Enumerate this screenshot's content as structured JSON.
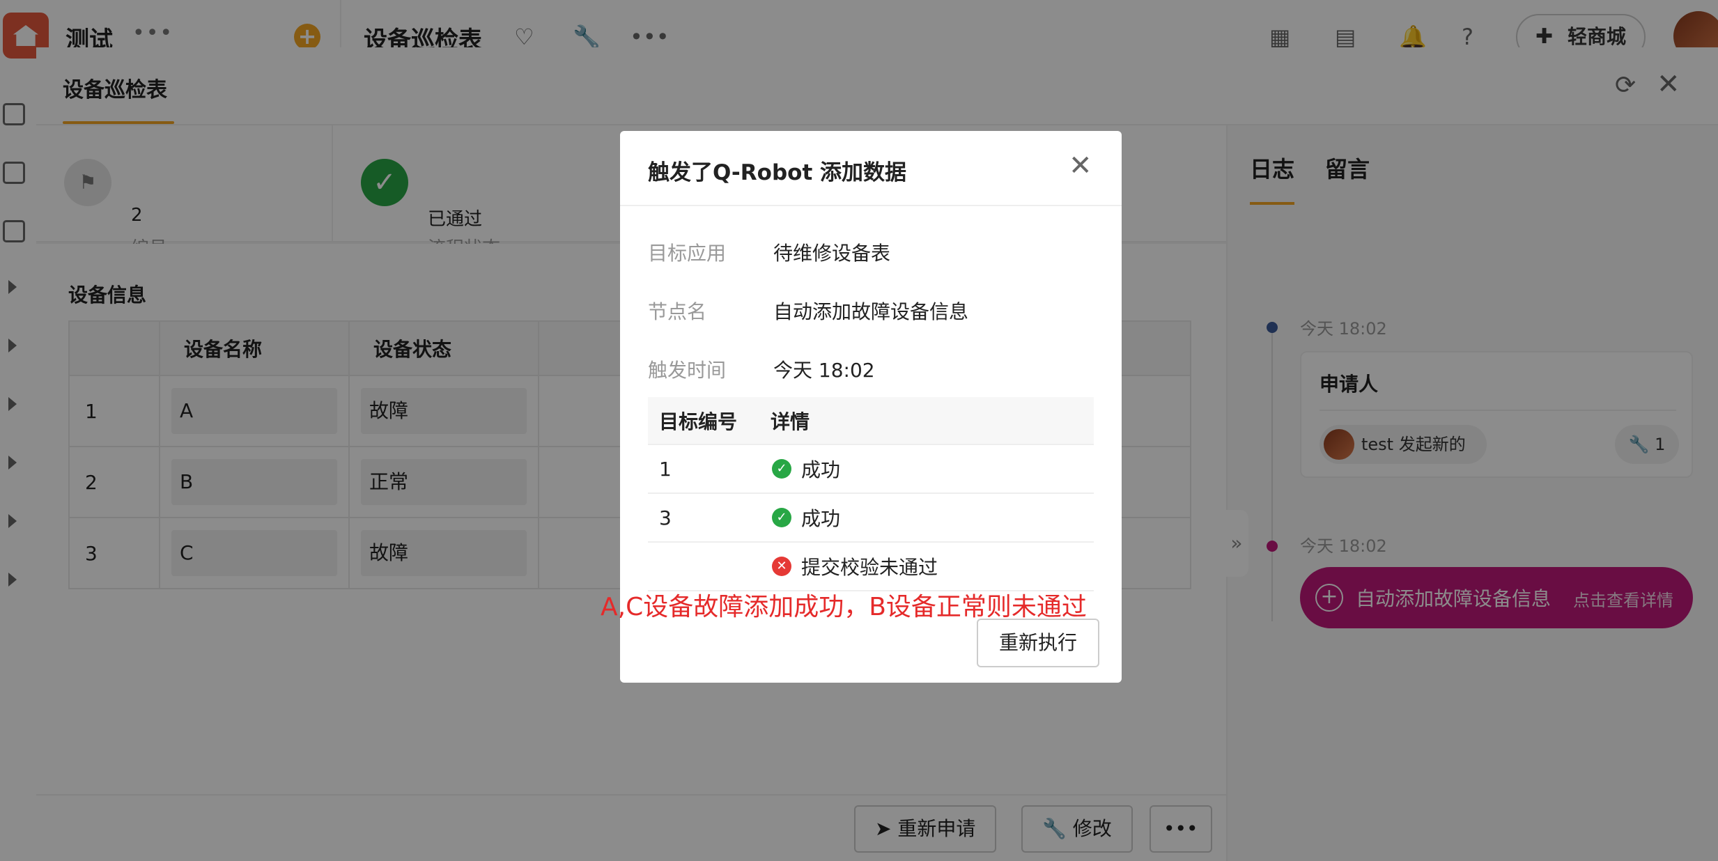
{
  "app": {
    "title": "测试",
    "form_title": "设备巡检表",
    "mall_label": "轻商城"
  },
  "drawer": {
    "tab_label": "设备巡检表",
    "summary": {
      "number_value": "2",
      "number_label": "编号",
      "status_value": "已通过",
      "status_label": "流程状态"
    },
    "section_title": "设备信息",
    "table": {
      "headers": [
        "",
        "设备名称",
        "设备状态",
        ""
      ],
      "rows": [
        {
          "index": "1",
          "name": "A",
          "status": "故障"
        },
        {
          "index": "2",
          "name": "B",
          "status": "正常"
        },
        {
          "index": "3",
          "name": "C",
          "status": "故障"
        }
      ]
    },
    "footer": {
      "reapply_label": "重新申请",
      "edit_label": "修改",
      "more_label": "•••"
    },
    "side": {
      "tab_log": "日志",
      "tab_comment": "留言",
      "entries": [
        {
          "time": "今天 18:02",
          "card_title": "申请人",
          "user_text": "test 发起新的",
          "badge_count": "1"
        },
        {
          "time": "今天 18:02",
          "robot_label": "自动添加故障设备信息",
          "robot_link": "点击查看详情"
        }
      ]
    }
  },
  "modal": {
    "title": "触发了Q-Robot 添加数据",
    "fields": [
      {
        "label": "目标应用",
        "value": "待维修设备表"
      },
      {
        "label": "节点名",
        "value": "自动添加故障设备信息"
      },
      {
        "label": "触发时间",
        "value": "今天 18:02"
      }
    ],
    "result_headers": [
      "目标编号",
      "详情"
    ],
    "results": [
      {
        "id": "1",
        "status": "success",
        "text": "成功"
      },
      {
        "id": "3",
        "status": "success",
        "text": "成功"
      },
      {
        "id": "",
        "status": "fail",
        "text": "提交校验未通过"
      }
    ],
    "retry_label": "重新执行"
  },
  "annotation": "A,C设备故障添加成功，B设备正常则未通过",
  "colors": {
    "accent": "#f5a623",
    "success": "#28a745",
    "fail": "#e53935",
    "robot": "#c0197a",
    "annotation": "#e52a2a"
  }
}
